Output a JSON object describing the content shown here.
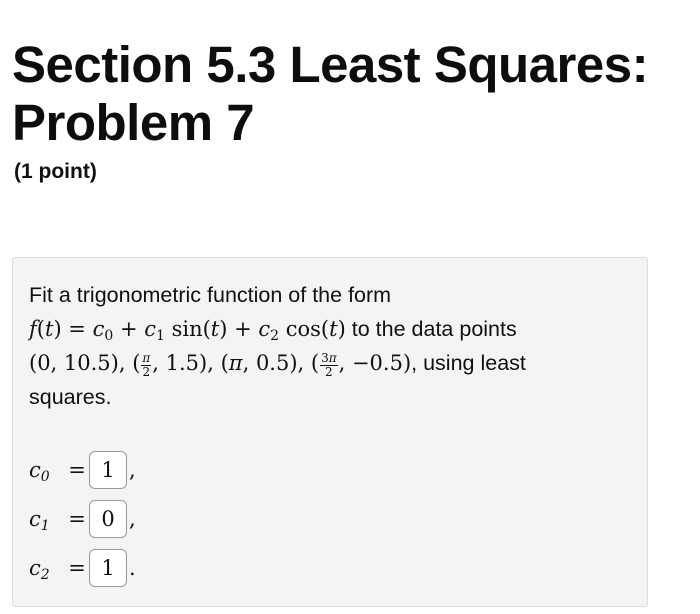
{
  "header": {
    "title_line1": "Section 5.3 Least Squares:",
    "title_line2": "Problem 7",
    "points": "(1 point)"
  },
  "problem": {
    "intro": "Fit a trigonometric function of the form",
    "lead_in": "to the data points",
    "tail": ", using least",
    "end": "squares."
  },
  "answers": [
    {
      "label": "c0",
      "value": "1",
      "punct": ","
    },
    {
      "label": "c1",
      "value": "0",
      "punct": ","
    },
    {
      "label": "c2",
      "value": "1",
      "punct": "."
    }
  ]
}
